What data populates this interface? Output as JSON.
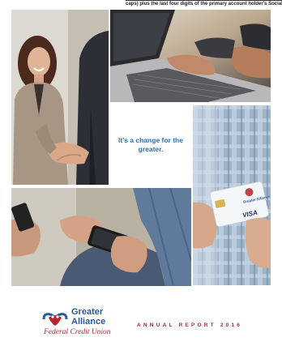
{
  "header_fragment": {
    "text": "caps) plus the last four digits of the primary account holder's Social Securi"
  },
  "photos": {
    "handshake": "Woman smiling and shaking hands",
    "laptop": "Hands typing on a laptop keyboard",
    "phone": "Hands holding smartphones",
    "card": "Hand holding a VISA debit card"
  },
  "tagline": "It's a change for the greater.",
  "logo": {
    "line1": "Greater",
    "line2": "Alliance",
    "line3": "Federal Credit Union"
  },
  "report_title": "ANNUAL REPORT 2016",
  "colors": {
    "brand_blue": "#2a5aa0",
    "brand_red": "#b3262d",
    "tagline_blue": "#2f6fb3"
  },
  "card_text": {
    "brand": "VISA",
    "issuer": "Greater Alliance"
  }
}
